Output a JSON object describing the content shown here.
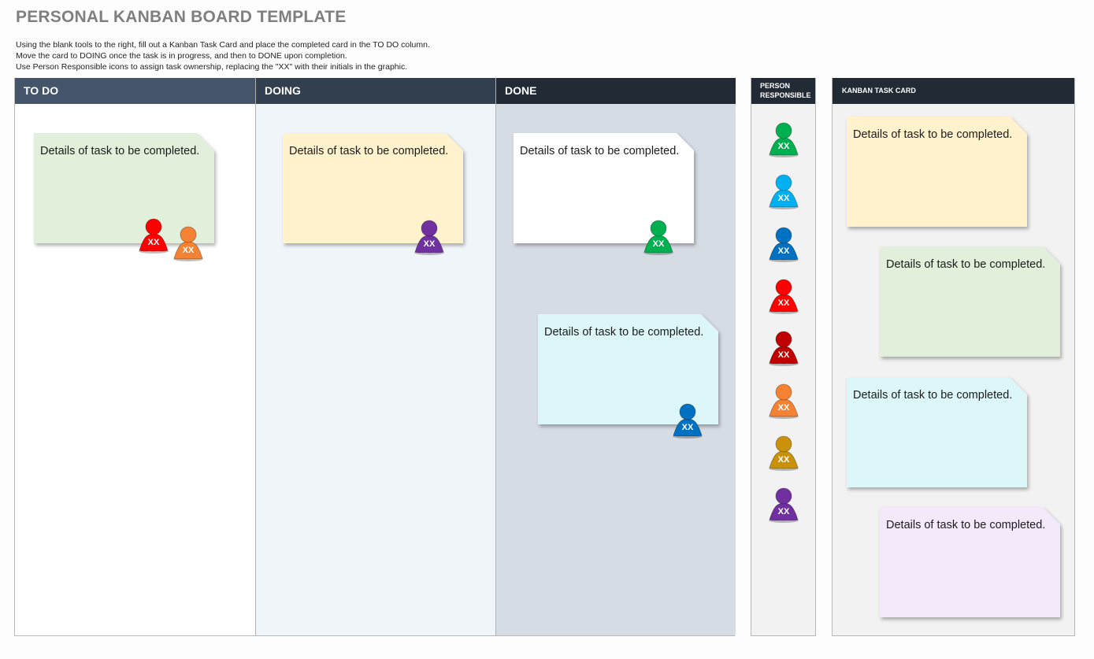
{
  "title": "PERSONAL KANBAN BOARD TEMPLATE",
  "instructions": [
    "Using the blank tools to the right, fill out a Kanban Task Card and place the completed card in the TO DO column.",
    "Move the card to DOING once the task is in progress, and then to DONE upon completion.",
    "Use Person Responsible icons to assign task ownership, replacing the \"XX\" with their initials in the graphic."
  ],
  "columns": [
    {
      "label": "TO DO",
      "header_color": "#44546a",
      "body_color": "#ffffff"
    },
    {
      "label": "DOING",
      "header_color": "#323f4f",
      "body_color": "#f0f5fa"
    },
    {
      "label": "DONE",
      "header_color": "#222a35",
      "body_color": "#d6dce4"
    }
  ],
  "board_cards": [
    {
      "column": "TO DO",
      "text": "Details of task to be completed.",
      "color": "#e2efda",
      "assignees": [
        {
          "initials": "XX",
          "color": "#ff0000"
        },
        {
          "initials": "XX",
          "color": "#f58233"
        }
      ]
    },
    {
      "column": "DOING",
      "text": "Details of task to be completed.",
      "color": "#fff2cc",
      "assignees": [
        {
          "initials": "XX",
          "color": "#7030a0"
        }
      ]
    },
    {
      "column": "DONE",
      "text": "Details of task to be completed.",
      "color": "#ffffff",
      "assignees": [
        {
          "initials": "XX",
          "color": "#00b050"
        }
      ]
    },
    {
      "column": "DONE",
      "text": "Details of task to be completed.",
      "color": "#ddf6f8",
      "assignees": [
        {
          "initials": "XX",
          "color": "#0070c0"
        }
      ]
    }
  ],
  "person_panel": {
    "header_line1": "PERSON",
    "header_line2": "RESPONSIBLE",
    "people": [
      {
        "initials": "XX",
        "color": "#00b050"
      },
      {
        "initials": "XX",
        "color": "#00b0f0"
      },
      {
        "initials": "XX",
        "color": "#0070c0"
      },
      {
        "initials": "XX",
        "color": "#ff0000"
      },
      {
        "initials": "XX",
        "color": "#c00000"
      },
      {
        "initials": "XX",
        "color": "#f58233"
      },
      {
        "initials": "XX",
        "color": "#c9920a"
      },
      {
        "initials": "XX",
        "color": "#7030a0"
      }
    ]
  },
  "task_card_panel": {
    "header": "KANBAN TASK CARD",
    "cards": [
      {
        "text": "Details of task to be completed.",
        "color": "#fff2cc"
      },
      {
        "text": "Details of task to be completed.",
        "color": "#e2efda"
      },
      {
        "text": "Details of task to be completed.",
        "color": "#ddf6f8"
      },
      {
        "text": "Details of task to be completed.",
        "color": "#f4e8fb"
      }
    ]
  }
}
